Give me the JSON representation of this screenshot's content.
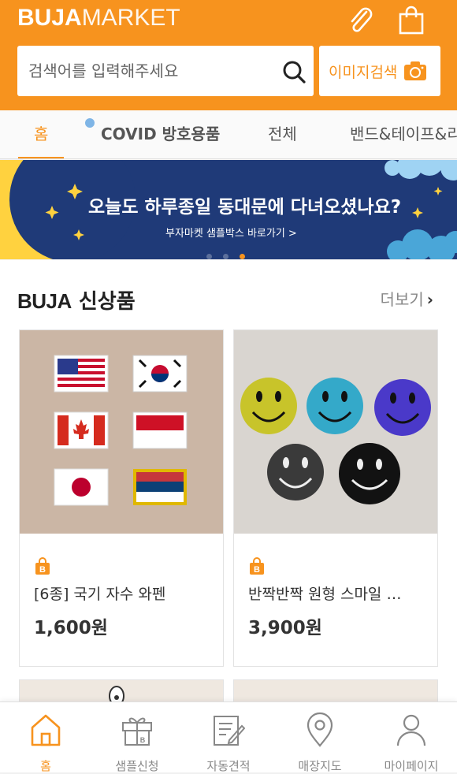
{
  "header": {
    "logo_bold": "BUJA",
    "logo_light": "MARKET",
    "search_placeholder": "검색어를 입력해주세요",
    "image_search_label": "이미지검색"
  },
  "tabs": [
    {
      "label": "홈",
      "active": true
    },
    {
      "label": "COVID 방호용품",
      "active": false
    },
    {
      "label": "전체",
      "active": false
    },
    {
      "label": "밴드&테이프&리",
      "active": false
    }
  ],
  "banner": {
    "main_text": "오늘도 하루종일 동대문에 다녀오셨나요?",
    "sub_text": "부자마켓 샘플박스 바로가기 >",
    "pager": {
      "count": 3,
      "active_index": 2
    }
  },
  "new_products": {
    "title_brand": "BUJA",
    "title_text": "신상품",
    "more_label": "더보기",
    "items": [
      {
        "name": "[6종] 국기 자수 와펜",
        "price": "1,600원"
      },
      {
        "name": "반짝반짝 원형 스마일 …",
        "price": "3,900원"
      }
    ]
  },
  "bottom_nav": [
    {
      "label": "홈",
      "icon": "home-icon",
      "active": true
    },
    {
      "label": "샘플신청",
      "icon": "gift-box-icon",
      "active": false
    },
    {
      "label": "자동견적",
      "icon": "quote-edit-icon",
      "active": false
    },
    {
      "label": "매장지도",
      "icon": "map-pin-icon",
      "active": false
    },
    {
      "label": "마이페이지",
      "icon": "user-icon",
      "active": false
    }
  ],
  "colors": {
    "brand": "#f7931e",
    "banner": "#1f3a78"
  }
}
